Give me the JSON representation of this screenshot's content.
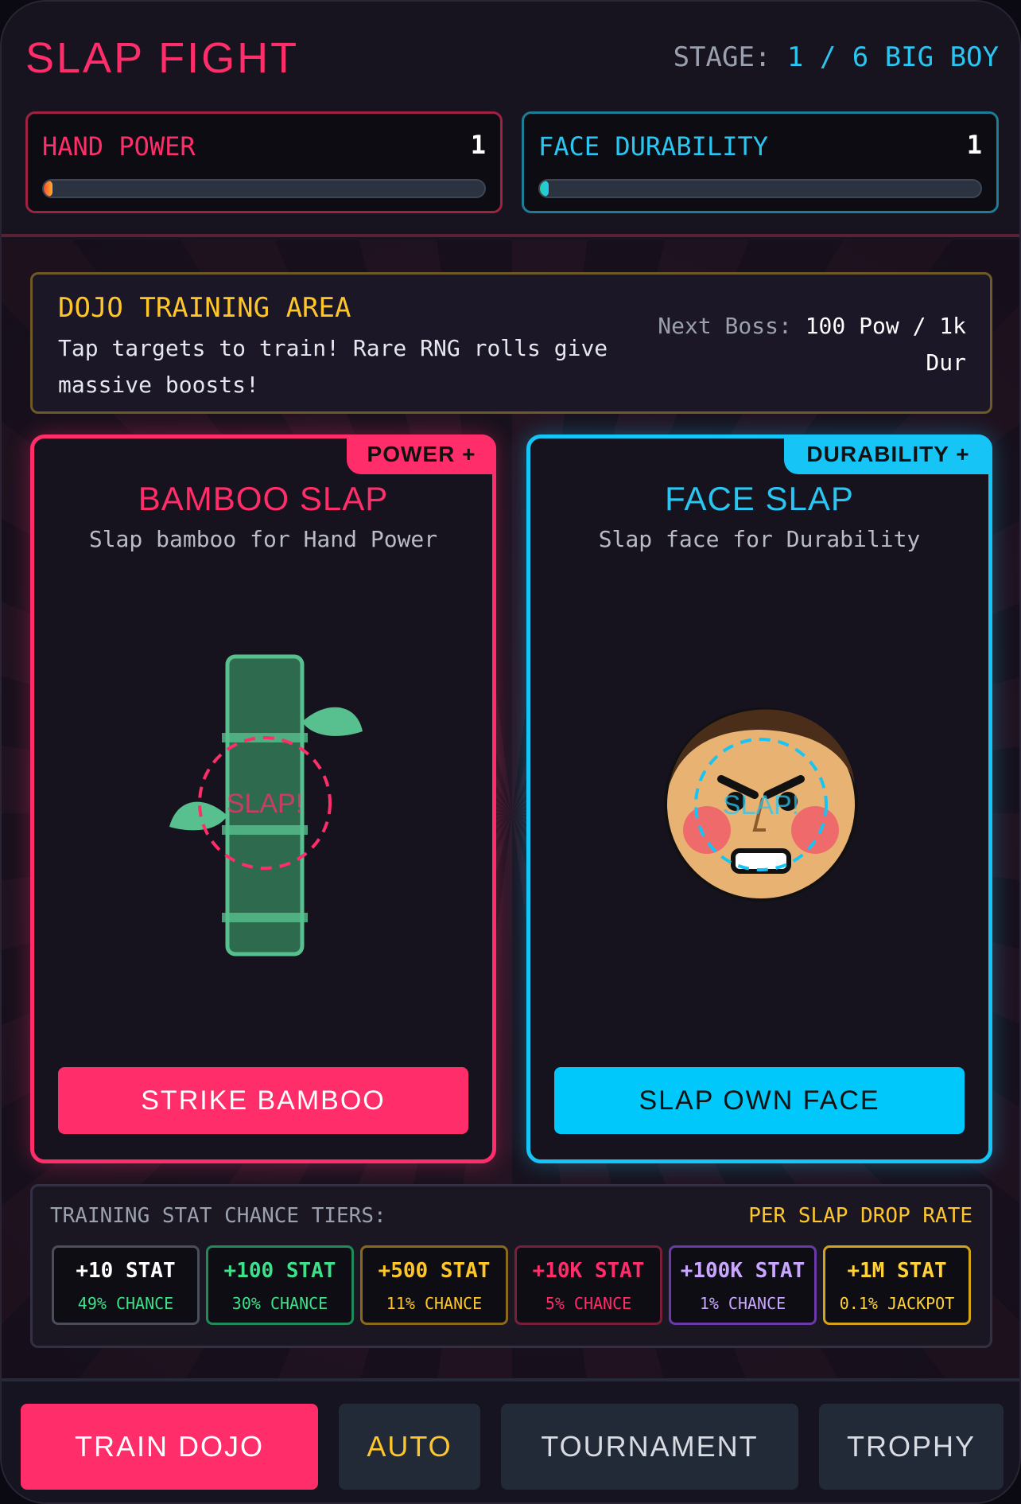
{
  "header": {
    "title": "SLAP FIGHT",
    "stage_label": "STAGE:",
    "stage_value": "1 / 6 BIG BOY"
  },
  "stats": {
    "hand_power": {
      "label": "HAND POWER",
      "value": "1",
      "fill_fraction": 0.02,
      "color": "#ff2d6a"
    },
    "face_durability": {
      "label": "FACE DURABILITY",
      "value": "1",
      "fill_fraction": 0.02,
      "color": "#29c6f2"
    }
  },
  "dojo": {
    "heading": "DOJO TRAINING AREA",
    "description": "Tap targets to train! Rare RNG rolls give massive boosts!",
    "next_boss_label": "Next Boss:",
    "next_boss_value": "100 Pow / 1k Dur"
  },
  "cards": {
    "bamboo": {
      "tag": "POWER +",
      "title": "BAMBOO SLAP",
      "subtitle": "Slap bamboo for Hand Power",
      "target_text": "SLAP!",
      "button": "STRIKE BAMBOO",
      "icon": "bamboo-icon"
    },
    "face": {
      "tag": "DURABILITY +",
      "title": "FACE SLAP",
      "subtitle": "Slap face for Durability",
      "target_text": "SLAP!",
      "button": "SLAP OWN FACE",
      "icon": "angry-face-icon"
    }
  },
  "tiers": {
    "heading": "TRAINING STAT CHANCE TIERS:",
    "rate_label": "PER SLAP DROP RATE",
    "items": [
      {
        "amount": "+10 STAT",
        "chance": "49% CHANCE",
        "color": "#4a4e5a",
        "amount_color": "#ffffff",
        "chance_color": "#3ee08a"
      },
      {
        "amount": "+100 STAT",
        "chance": "30% CHANCE",
        "color": "#1f8a5a",
        "amount_color": "#3ee08a",
        "chance_color": "#3ee08a"
      },
      {
        "amount": "+500 STAT",
        "chance": "11% CHANCE",
        "color": "#8a6a1a",
        "amount_color": "#ffc629",
        "chance_color": "#ffc629"
      },
      {
        "amount": "+10K STAT",
        "chance": "5% CHANCE",
        "color": "#7a1f38",
        "amount_color": "#ff2d6a",
        "chance_color": "#ff2d6a"
      },
      {
        "amount": "+100K STAT",
        "chance": "1% CHANCE",
        "color": "#6a3aa8",
        "amount_color": "#c9a6ff",
        "chance_color": "#c9a6ff"
      },
      {
        "amount": "+1M STAT",
        "chance": "0.1% JACKPOT",
        "color": "#d4a418",
        "amount_color": "#ffd23a",
        "chance_color": "#ffd23a"
      }
    ]
  },
  "nav": {
    "train": "TRAIN DOJO",
    "auto": "AUTO",
    "tournament": "TOURNAMENT",
    "trophy": "TROPHY"
  }
}
